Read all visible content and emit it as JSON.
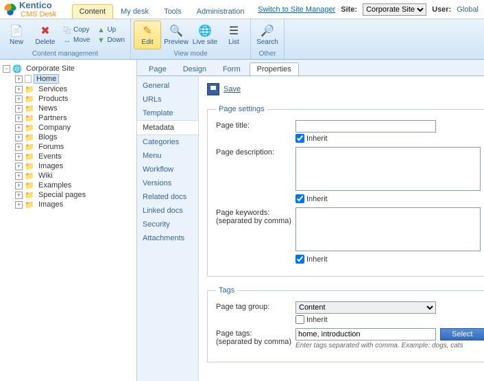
{
  "logo": {
    "line1": "Kentico",
    "line2": "CMS Desk"
  },
  "header_links": {
    "switch": "Switch to Site Manager",
    "site_label": "Site:",
    "site_value": "Corporate Site",
    "user_label": "User:",
    "user_value": "Global"
  },
  "main_tabs": [
    "Content",
    "My desk",
    "Tools",
    "Administration"
  ],
  "main_tab_active": 0,
  "ribbon": {
    "group_cm": "Content management",
    "group_vm": "View mode",
    "group_other": "Other",
    "new": "New",
    "delete": "Delete",
    "copy": "Copy",
    "move": "Move",
    "up": "Up",
    "down": "Down",
    "edit": "Edit",
    "preview": "Preview",
    "live": "Live site",
    "list": "List",
    "search": "Search"
  },
  "tree": {
    "root": "Corporate Site",
    "items": [
      {
        "label": "Home",
        "icon": "doc",
        "selected": true
      },
      {
        "label": "Services",
        "icon": "folder"
      },
      {
        "label": "Products",
        "icon": "folder"
      },
      {
        "label": "News",
        "icon": "folder"
      },
      {
        "label": "Partners",
        "icon": "folder"
      },
      {
        "label": "Company",
        "icon": "folder"
      },
      {
        "label": "Blogs",
        "icon": "folder"
      },
      {
        "label": "Forums",
        "icon": "folder"
      },
      {
        "label": "Events",
        "icon": "folder"
      },
      {
        "label": "Images",
        "icon": "folder"
      },
      {
        "label": "Wiki",
        "icon": "folder"
      },
      {
        "label": "Examples",
        "icon": "folder"
      },
      {
        "label": "Special pages",
        "icon": "folder-sp"
      },
      {
        "label": "Images",
        "icon": "folder"
      }
    ]
  },
  "sub_tabs": [
    "Page",
    "Design",
    "Form",
    "Properties"
  ],
  "sub_tab_active": 3,
  "side_menu": [
    "General",
    "URLs",
    "Template",
    "Metadata",
    "Categories",
    "Menu",
    "Workflow",
    "Versions",
    "Related docs",
    "Linked docs",
    "Security",
    "Attachments"
  ],
  "side_active": 3,
  "form": {
    "save": "Save",
    "legend_page": "Page settings",
    "page_title_label": "Page title:",
    "page_title_value": "",
    "inherit_label": "Inherit",
    "page_desc_label": "Page description:",
    "page_desc_value": "",
    "page_keywords_label": "Page keywords:",
    "page_keywords_sub": "(separated by comma)",
    "page_keywords_value": "",
    "legend_tags": "Tags",
    "tag_group_label": "Page tag group:",
    "tag_group_value": "Content",
    "page_tags_label": "Page tags:",
    "page_tags_sub": "(separated by comma)",
    "page_tags_value": "home, introduction",
    "select_btn": "Select",
    "tags_hint": "Enter tags separated with comma. Example: dogs, cats"
  }
}
